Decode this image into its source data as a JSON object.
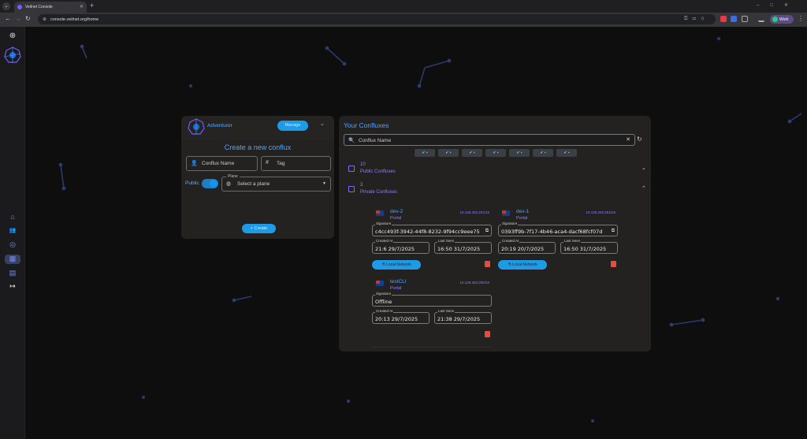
{
  "browser": {
    "tab_title": "Veilnet Console",
    "tab_close": "✕",
    "new_tab": "+",
    "url": "console.veilnet.org/home",
    "profile_label": "Work",
    "menu": "⋮"
  },
  "sidebar": {
    "items": [
      {
        "name": "home",
        "icon": "⌂"
      },
      {
        "name": "users",
        "icon": "👥"
      },
      {
        "name": "globe",
        "icon": "◎"
      },
      {
        "name": "grid",
        "icon": "▦"
      },
      {
        "name": "server",
        "icon": "▤"
      },
      {
        "name": "logout",
        "icon": "↦"
      }
    ]
  },
  "user": {
    "name": "Adventurer",
    "manage_label": "Manage",
    "expand_icon": "⌄"
  },
  "create": {
    "title": "Create a new conflux",
    "name_placeholder": "Conflux Name",
    "tag_placeholder": "Tag",
    "public_label": "Public",
    "plane_label": "Plane",
    "plane_placeholder": "Select a plane",
    "create_label": "+ Create"
  },
  "confluxes": {
    "title": "Your Confluxes",
    "search_placeholder": "Conflux Name",
    "search_icon": "🔍",
    "clear_icon": "✕",
    "refresh_icon": "↻",
    "filter_chips": [
      "✔ ▪",
      "✔ ▪",
      "✔ ▪",
      "✔ ▪",
      "✔ ▪",
      "✔ ▪",
      "✔ ▪"
    ],
    "public_group": {
      "count": "10",
      "label": "Public Confluxes",
      "chevron": "⌄"
    },
    "private_group": {
      "count": "3",
      "label": "Private Confluxes",
      "chevron": "⌃"
    },
    "nodes": [
      {
        "name": "dev-2",
        "type": "Portal",
        "ip": "10.128.253.201/16",
        "signature_label": "Signature",
        "signature": "c4cc493f-3942-44f8-8232-9f94cc9eee75",
        "created_label": "Created At",
        "created": "21:6 29/7/2025",
        "seen_label": "Last Seen",
        "seen": "16:50 31/7/2025",
        "local_network": "Local Network"
      },
      {
        "name": "dev-1",
        "type": "Portal",
        "ip": "10.128.253.254/16",
        "signature_label": "Signature",
        "signature": "0393ff9b-7f17-4b46-aca4-dacf68fcf07d",
        "created_label": "Created At",
        "created": "20:19 20/7/2025",
        "seen_label": "Last Seen",
        "seen": "16:50 31/7/2025",
        "local_network": "Local Network"
      },
      {
        "name": "testCLI",
        "type": "Portal",
        "ip": "10.128.253.250/16",
        "signature_label": "Signature",
        "signature": "Offline",
        "created_label": "Created At",
        "created": "20:13 29/7/2025",
        "seen_label": "Last Seen",
        "seen": "21:38 29/7/2025"
      }
    ]
  },
  "colors": {
    "accent": "#1e9be6",
    "title_blue": "#4da3ff",
    "purple": "#8f7dff",
    "danger": "#e74c3c"
  }
}
